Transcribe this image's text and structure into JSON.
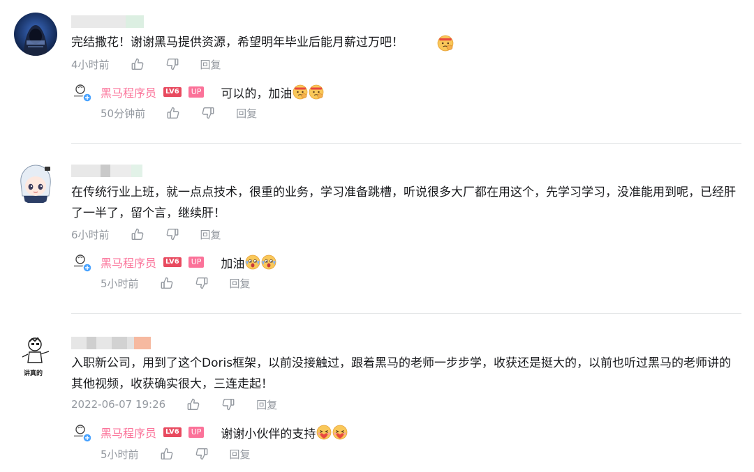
{
  "comments": [
    {
      "text": "完结撒花！谢谢黑马提供资源，希望明年毕业后能月薪过万吧！",
      "time": "4小时前",
      "reply_label": "回复",
      "reply": {
        "user": "黑马程序员",
        "level": "LV6",
        "up_badge": "UP",
        "text": "可以的，加油",
        "time": "50分钟前",
        "reply_label": "回复"
      }
    },
    {
      "text": "在传统行业上班，就一点点技术，很重的业务，学习准备跳槽，听说很多大厂都在用这个，先学习学习，没准能用到呢，已经肝了一半了，留个言，继续肝！",
      "time": "6小时前",
      "reply_label": "回复",
      "reply": {
        "user": "黑马程序员",
        "level": "LV6",
        "up_badge": "UP",
        "text": "加油",
        "time": "5小时前",
        "reply_label": "回复"
      }
    },
    {
      "text": "入职新公司，用到了这个Doris框架，以前没接触过，跟着黑马的老师一步步学，收获还是挺大的，以前也听过黑马的老师讲的其他视频，收获确实很大，三连走起！",
      "time": "2022-06-07 19:26",
      "reply_label": "回复",
      "avatar_caption": "讲真的",
      "reply": {
        "user": "黑马程序员",
        "level": "LV6",
        "up_badge": "UP",
        "text": "谢谢小伙伴的支持",
        "time": "5小时前",
        "reply_label": "回复"
      }
    }
  ],
  "icons": {
    "like": "thumbs-up-icon",
    "dislike": "thumbs-down-icon",
    "emoji": "emoji-icon"
  },
  "colors": {
    "username_pink": "#fb7299",
    "meta_gray": "#9499a0",
    "text": "#18191c"
  }
}
